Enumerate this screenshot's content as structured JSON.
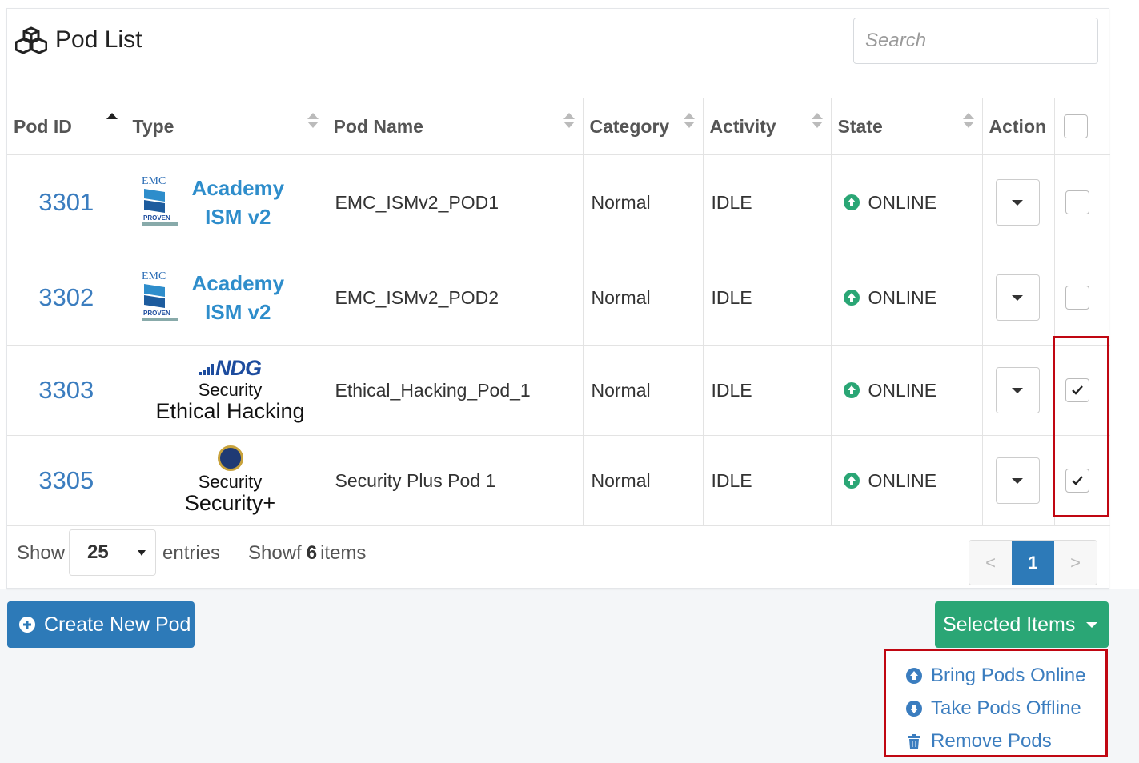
{
  "header": {
    "icon": "cubes-icon",
    "title": "Pod List",
    "search_placeholder": "Search"
  },
  "columns": [
    "Pod ID",
    "Type",
    "Pod Name",
    "Category",
    "Activity",
    "State",
    "Action"
  ],
  "rows": [
    {
      "id": "3301",
      "type": {
        "kind": "emc",
        "logo_text": "EMC",
        "logo_sub": "PROVEN",
        "line1": "Academy",
        "line2": "ISM v2"
      },
      "name": "EMC_ISMv2_POD1",
      "category": "Normal",
      "activity": "IDLE",
      "state": "ONLINE",
      "checked": false
    },
    {
      "id": "3302",
      "type": {
        "kind": "emc",
        "logo_text": "EMC",
        "logo_sub": "PROVEN",
        "line1": "Academy",
        "line2": "ISM v2"
      },
      "name": "EMC_ISMv2_POD2",
      "category": "Normal",
      "activity": "IDLE",
      "state": "ONLINE",
      "checked": false
    },
    {
      "id": "3303",
      "type": {
        "kind": "ndg",
        "logo": "NDG",
        "line1": "Security",
        "line2": "Ethical Hacking"
      },
      "name": "Ethical_Hacking_Pod_1",
      "category": "Normal",
      "activity": "IDLE",
      "state": "ONLINE",
      "checked": true
    },
    {
      "id": "3305",
      "type": {
        "kind": "seal",
        "line1": "Security",
        "line2": "Security+"
      },
      "name": "Security Plus Pod 1",
      "category": "Normal",
      "activity": "IDLE",
      "state": "ONLINE",
      "checked": true
    }
  ],
  "footer": {
    "show_label": "Show",
    "page_size": "25",
    "entries_label": "entries",
    "showing_prefix": "Showf",
    "showing_count": "6",
    "showing_suffix": "items",
    "pager": {
      "prev": "<",
      "current": "1",
      "next": ">"
    }
  },
  "buttons": {
    "create": "Create New Pod",
    "selected": "Selected Items"
  },
  "menu": {
    "items": [
      {
        "label": "Bring Pods Online",
        "icon": "circle-arrow-up-icon"
      },
      {
        "label": "Take Pods Offline",
        "icon": "circle-arrow-down-icon"
      },
      {
        "label": "Remove Pods",
        "icon": "trash-icon"
      }
    ]
  },
  "colors": {
    "primary": "#2d7ab8",
    "success": "#2aa675",
    "link": "#3b7dbf",
    "online": "#2aa675",
    "highlight": "#c00712"
  }
}
